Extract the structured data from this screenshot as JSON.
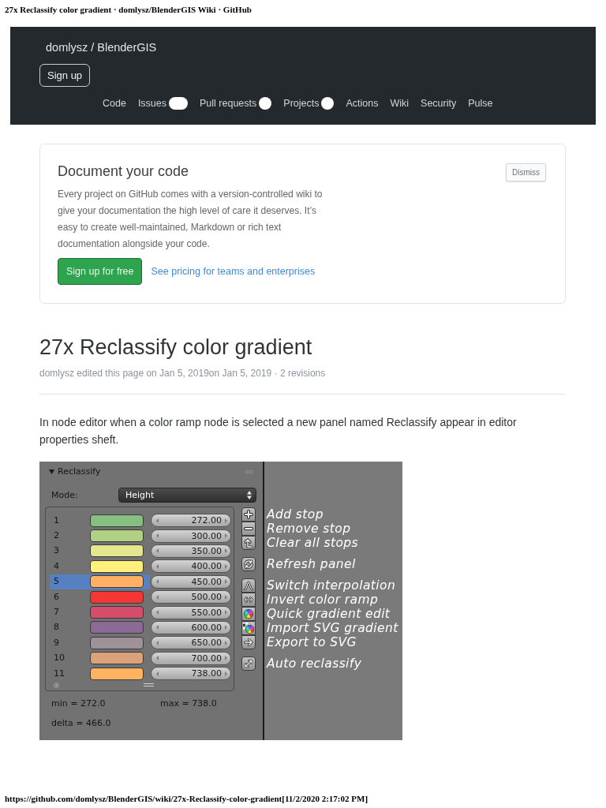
{
  "print_header": {
    "title": "27x Reclassify color gradient · domlysz/BlenderGIS Wiki · GitHub"
  },
  "repo_header": {
    "repo": "domlysz / BlenderGIS",
    "signup_button": "Sign up",
    "nav": [
      {
        "kind": "plain",
        "label": "Code"
      },
      {
        "kind": "pill",
        "label": "Issues"
      },
      {
        "kind": "dot",
        "label": "Pull requests"
      },
      {
        "kind": "dot",
        "label": "Projects"
      },
      {
        "kind": "plain",
        "label": "Actions"
      },
      {
        "kind": "plain",
        "label": "Wiki"
      },
      {
        "kind": "plain",
        "label": "Security"
      },
      {
        "kind": "plain",
        "label": "Pulse"
      }
    ]
  },
  "wiki_prompt": {
    "title": "Document your code",
    "text": "Every project on GitHub comes with a version-controlled wiki to give your documentation the high level of care it deserves. It’s easy to create well-maintained, Markdown or rich text documentation alongside your code.",
    "primary_button": "Sign up for free",
    "link": "See pricing for teams and enterprises",
    "dismiss_button": "Dismiss"
  },
  "article": {
    "title": "27x Reclassify color gradient",
    "meta": "domlysz edited this page on Jan 5, 2019on Jan 5, 2019 · 2 revisions",
    "body": "In node editor when a color ramp node is selected a new panel named Reclassify appear in editor properties sheft."
  },
  "figure": {
    "panel": {
      "title": "Reclassify",
      "expanded": true,
      "mode_label": "Mode:",
      "mode_value": "Height",
      "stops": [
        {
          "index": "1",
          "color": "#86bf80",
          "value": "272.00",
          "selected": false
        },
        {
          "index": "2",
          "color": "#b2d083",
          "value": "300.00",
          "selected": false
        },
        {
          "index": "3",
          "color": "#e4e78e",
          "value": "350.00",
          "selected": false
        },
        {
          "index": "4",
          "color": "#fff07e",
          "value": "400.00",
          "selected": false
        },
        {
          "index": "5",
          "color": "#ffb063",
          "value": "450.00",
          "selected": true
        },
        {
          "index": "6",
          "color": "#f63535",
          "value": "500.00",
          "selected": false
        },
        {
          "index": "7",
          "color": "#d54d6a",
          "value": "550.00",
          "selected": false
        },
        {
          "index": "8",
          "color": "#8b6a95",
          "value": "600.00",
          "selected": false
        },
        {
          "index": "9",
          "color": "#9e9198",
          "value": "650.00",
          "selected": false
        },
        {
          "index": "10",
          "color": "#dba27a",
          "value": "700.00",
          "selected": false
        },
        {
          "index": "11",
          "color": "#ffb260",
          "value": "738.00",
          "selected": false
        }
      ],
      "min": "min = 272.0",
      "max": "max = 738.0",
      "delta": "delta = 466.0"
    },
    "tool_groups": [
      {
        "tools": [
          {
            "kind": "add",
            "label": "Add stop"
          },
          {
            "kind": "remove",
            "label": "Remove stop"
          },
          {
            "kind": "clear",
            "label": "Clear all stops"
          }
        ]
      },
      {
        "tools": [
          {
            "kind": "refresh",
            "label": "Refresh panel"
          }
        ]
      },
      {
        "tools": [
          {
            "kind": "interpolation",
            "label": "Switch interpolation"
          },
          {
            "kind": "invert",
            "label": "Invert color ramp"
          },
          {
            "kind": "wheel",
            "label": "Quick gradient edit"
          },
          {
            "kind": "import",
            "label": "Import SVG gradient"
          },
          {
            "kind": "export",
            "label": "Export to SVG"
          }
        ]
      },
      {
        "tools": [
          {
            "kind": "auto",
            "label": "Auto reclassify"
          }
        ]
      }
    ]
  },
  "print_footer": {
    "url": "https://github.com/domlysz/BlenderGIS/wiki/27x-Reclassify-color-gradient[11/2/2020 2:17:02 PM]"
  }
}
